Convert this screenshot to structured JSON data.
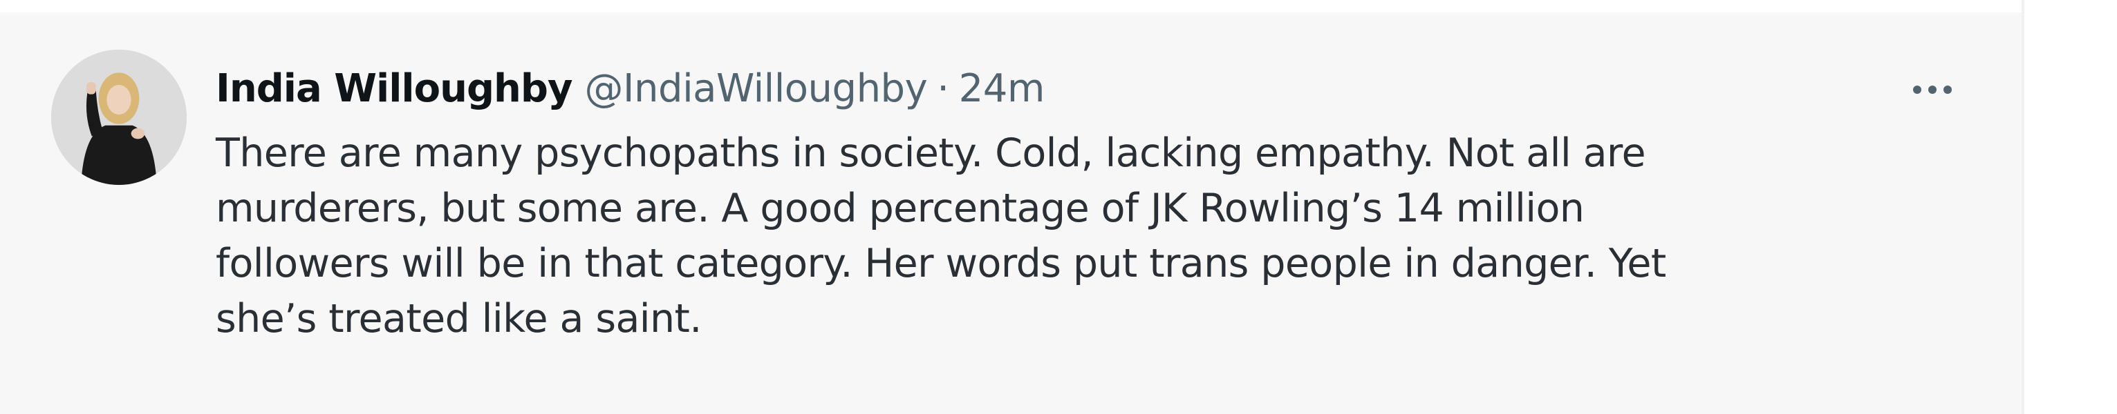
{
  "tweet": {
    "author_name": "India Willoughby",
    "handle": "@IndiaWilloughby",
    "separator": "·",
    "time": "24m",
    "text_lines": [
      "There are many psychopaths in society. Cold, lacking empathy. Not all are",
      "murderers, but some are. A good percentage of JK Rowling’s 14 million",
      "followers will be in that category. Her words put trans people in danger. Yet",
      "she’s treated like a saint."
    ],
    "avatar_icon": "profile-photo",
    "more_icon": "more-options-icon"
  },
  "colors": {
    "card_background": "#f7f7f7",
    "name": "#0f1419",
    "secondary": "#536471",
    "body": "#2a2f35"
  }
}
